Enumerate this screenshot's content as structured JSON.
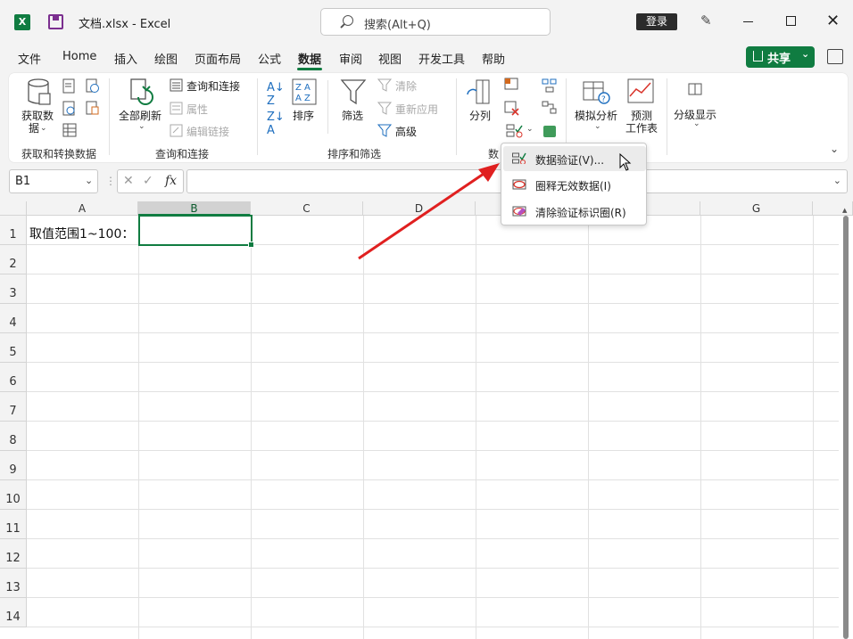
{
  "window": {
    "app_icon": "X",
    "title": "文档.xlsx  -  Excel",
    "search_placeholder": "搜索(Alt+Q)",
    "login_label": "登录"
  },
  "tabs": [
    "文件",
    "Home",
    "插入",
    "绘图",
    "页面布局",
    "公式",
    "数据",
    "审阅",
    "视图",
    "开发工具",
    "帮助"
  ],
  "active_tab": "数据",
  "share_label": "共享",
  "ribbon": {
    "groups": {
      "get_transform": "获取和转换数据",
      "queries": "查询和连接",
      "sort_filter": "排序和筛选",
      "data_tools": "数",
      "forecast": "预测"
    },
    "get_data_label_1": "获取数",
    "get_data_label_2": "据",
    "refresh_all": "全部刷新",
    "queries_connections": "查询和连接",
    "properties": "属性",
    "edit_links": "编辑链接",
    "sort": "排序",
    "filter": "筛选",
    "clear": "清除",
    "reapply": "重新应用",
    "advanced": "高级",
    "text_to_columns": "分列",
    "what_if": "模拟分析",
    "forecast_sheet_1": "预测",
    "forecast_sheet_2": "工作表",
    "outline": "分级显示"
  },
  "formula_bar": {
    "name_box": "B1",
    "fx": "fx",
    "formula": ""
  },
  "grid": {
    "columns": [
      "A",
      "B",
      "C",
      "D",
      "E",
      "F",
      "G"
    ],
    "selected_column": "B",
    "rows": [
      "1",
      "2",
      "3",
      "4",
      "5",
      "6",
      "7",
      "8",
      "9",
      "10",
      "11",
      "12",
      "13",
      "14"
    ],
    "cell_A1": "取值范围1~100：",
    "selected_cell": "B1"
  },
  "dropdown": {
    "items": [
      {
        "label": "数据验证(V)...",
        "icon": "data-validation-icon"
      },
      {
        "label": "圈释无效数据(I)",
        "icon": "circle-invalid-icon"
      },
      {
        "label": "清除验证标识圈(R)",
        "icon": "clear-circles-icon"
      }
    ]
  },
  "colors": {
    "accent": "#107c41",
    "arrow": "#e02020"
  }
}
